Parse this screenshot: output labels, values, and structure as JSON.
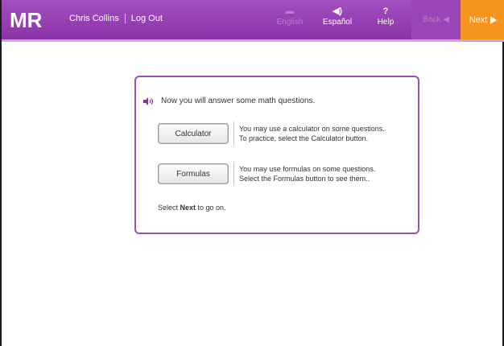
{
  "header": {
    "logo_text": "MR",
    "user_name": "Chris Collins",
    "logout_label": "Log Out",
    "tools": [
      {
        "icon": "translate-icon",
        "glyph": "▬",
        "label": "English",
        "enabled": false
      },
      {
        "icon": "speaker-icon",
        "glyph": "◀)",
        "label": "Español",
        "enabled": true
      },
      {
        "icon": "help-icon",
        "glyph": "?",
        "label": "Help",
        "enabled": true
      }
    ],
    "back_label": "Back",
    "next_label": "Next"
  },
  "dialog": {
    "intro": "Now you will answer some math questions.",
    "rows": [
      {
        "button": "Calculator",
        "line1": "You may use a calculator on some questions.",
        "line2": "To practice, select the Calculator button."
      },
      {
        "button": "Formulas",
        "line1": "You may use formulas on some questions.",
        "line2": "Select the Formulas button to see them.."
      }
    ],
    "finish_prefix": "Select ",
    "finish_bold": "Next",
    "finish_suffix": " to go on."
  },
  "colors": {
    "brand": "#8a33a8",
    "accent": "#f7941d",
    "dialog_border": "#9b4fb8"
  }
}
